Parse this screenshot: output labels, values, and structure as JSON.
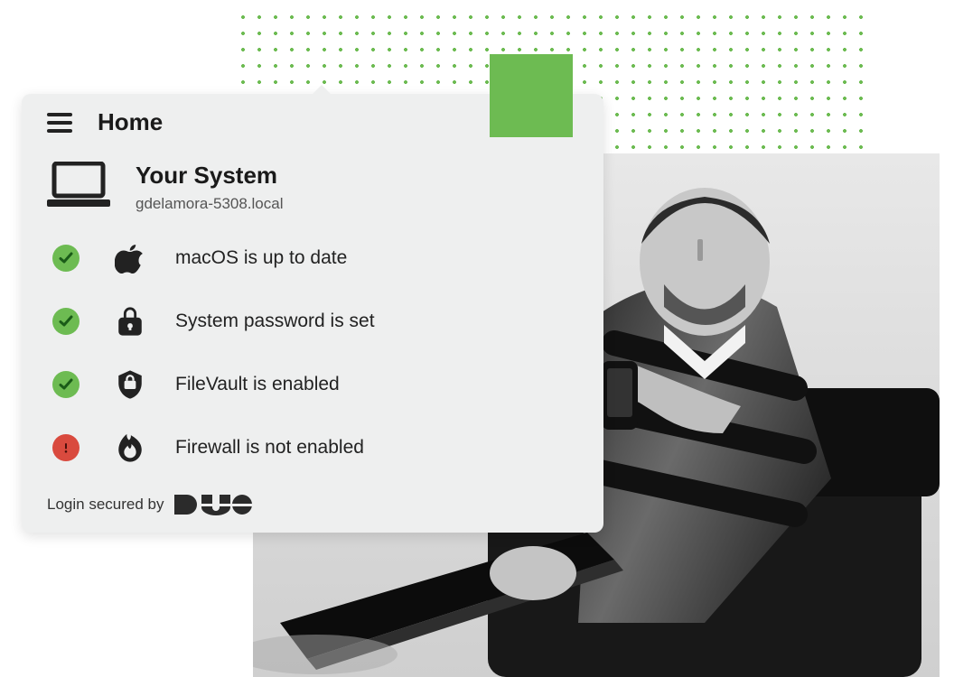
{
  "header": {
    "title": "Home"
  },
  "system": {
    "heading": "Your System",
    "hostname": "gdelamora-5308.local"
  },
  "checks": [
    {
      "status": "ok",
      "icon": "apple-icon",
      "label": "macOS is up to date"
    },
    {
      "status": "ok",
      "icon": "lock-icon",
      "label": "System password is set"
    },
    {
      "status": "ok",
      "icon": "shield-icon",
      "label": "FileVault is enabled"
    },
    {
      "status": "warn",
      "icon": "flame-icon",
      "label": "Firewall is not enabled"
    }
  ],
  "footer": {
    "secured_by": "Login secured by",
    "brand": "DUO"
  },
  "colors": {
    "accent_green": "#6dbb52",
    "warn_red": "#d94a3e"
  }
}
